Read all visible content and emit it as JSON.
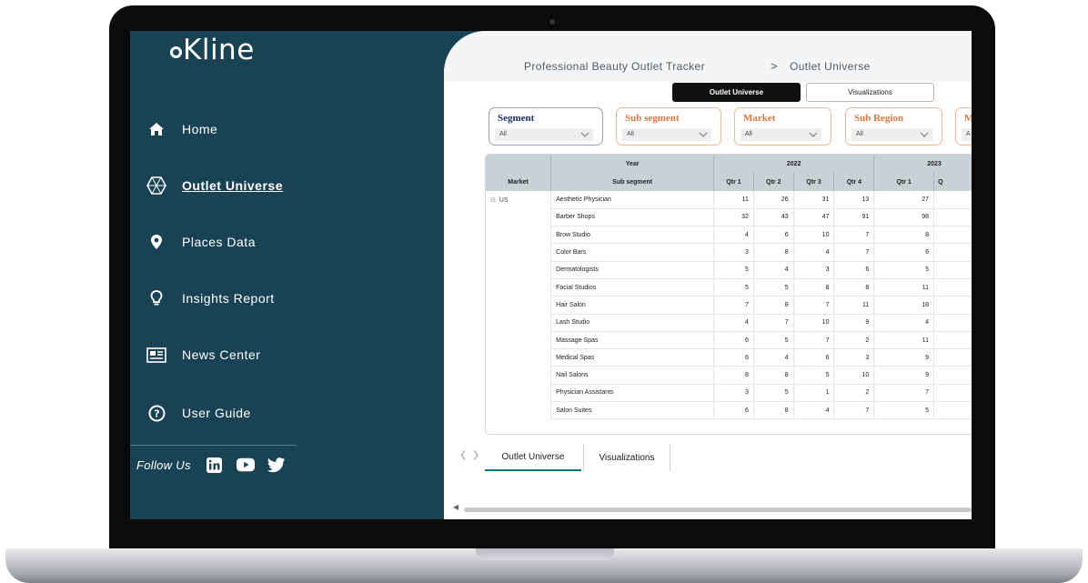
{
  "app": {
    "logo": "Kline"
  },
  "sidebar": {
    "items": [
      {
        "label": "Home",
        "icon": "home-icon",
        "active": false
      },
      {
        "label": "Outlet Universe",
        "icon": "hexagon-grid-icon",
        "active": true
      },
      {
        "label": "Places Data",
        "icon": "map-pin-icon",
        "active": false
      },
      {
        "label": "Insights Report",
        "icon": "lightbulb-icon",
        "active": false
      },
      {
        "label": "News Center",
        "icon": "newspaper-icon",
        "active": false
      },
      {
        "label": "User Guide",
        "icon": "question-circle-icon",
        "active": false
      }
    ],
    "follow_label": "Follow Us",
    "social": [
      "linkedin-icon",
      "youtube-icon",
      "twitter-icon"
    ]
  },
  "header": {
    "breadcrumb_root": "Professional Beauty Outlet Tracker",
    "breadcrumb_sep": ">",
    "breadcrumb_current": "Outlet Universe"
  },
  "view_toggle": {
    "active": "Outlet Universe",
    "inactive": "Visualizations"
  },
  "slicers": [
    {
      "title": "Segment",
      "value": "All",
      "color": "#1f2f6b"
    },
    {
      "title": "Sub segment",
      "value": "All",
      "color": "#e0743a"
    },
    {
      "title": "Market",
      "value": "All",
      "color": "#e0743a"
    },
    {
      "title": "Sub Region",
      "value": "All",
      "color": "#e0743a"
    },
    {
      "title": "M",
      "value": "A",
      "color": "#e0743a"
    }
  ],
  "table": {
    "year_label": "Year",
    "years": [
      "2022",
      "2023"
    ],
    "col_market": "Market",
    "col_subsegment": "Sub segment",
    "quarters_2022": [
      "Qtr 1",
      "Qtr 2",
      "Qtr 3",
      "Qtr 4"
    ],
    "quarters_2023": [
      "Qtr 1",
      "Q"
    ],
    "market": "US",
    "market_expander": "⊟",
    "rows": [
      {
        "name": "Aesthetic Physician",
        "vals": [
          "11",
          "26",
          "31",
          "13",
          "27"
        ]
      },
      {
        "name": "Barber Shops",
        "vals": [
          "32",
          "43",
          "47",
          "91",
          "98"
        ]
      },
      {
        "name": "Brow Studio",
        "vals": [
          "4",
          "6",
          "10",
          "7",
          "8"
        ]
      },
      {
        "name": "Color Bars",
        "vals": [
          "3",
          "8",
          "4",
          "7",
          "6"
        ]
      },
      {
        "name": "Dermatologists",
        "vals": [
          "5",
          "4",
          "3",
          "6",
          "5"
        ]
      },
      {
        "name": "Facial Studios",
        "vals": [
          "5",
          "5",
          "8",
          "8",
          "11"
        ]
      },
      {
        "name": "Hair Salon",
        "vals": [
          "7",
          "8",
          "7",
          "11",
          "18"
        ]
      },
      {
        "name": "Lash Studio",
        "vals": [
          "4",
          "7",
          "10",
          "9",
          "4"
        ]
      },
      {
        "name": "Massage Spas",
        "vals": [
          "6",
          "5",
          "7",
          "2",
          "11"
        ]
      },
      {
        "name": "Medical Spas",
        "vals": [
          "6",
          "4",
          "6",
          "3",
          "9"
        ]
      },
      {
        "name": "Nail Salons",
        "vals": [
          "8",
          "8",
          "5",
          "10",
          "9"
        ]
      },
      {
        "name": "Physician Assistants",
        "vals": [
          "3",
          "5",
          "1",
          "2",
          "7"
        ]
      },
      {
        "name": "Salon Suites",
        "vals": [
          "6",
          "8",
          "4",
          "7",
          "5"
        ]
      }
    ]
  },
  "page_tabs": [
    "Outlet Universe",
    "Visualizations"
  ],
  "colors": {
    "sidebar_bg": "#194254",
    "header_row": "#c8d2d6",
    "accent_tab": "#0f766e",
    "slicer_border": "#f0b79a"
  }
}
